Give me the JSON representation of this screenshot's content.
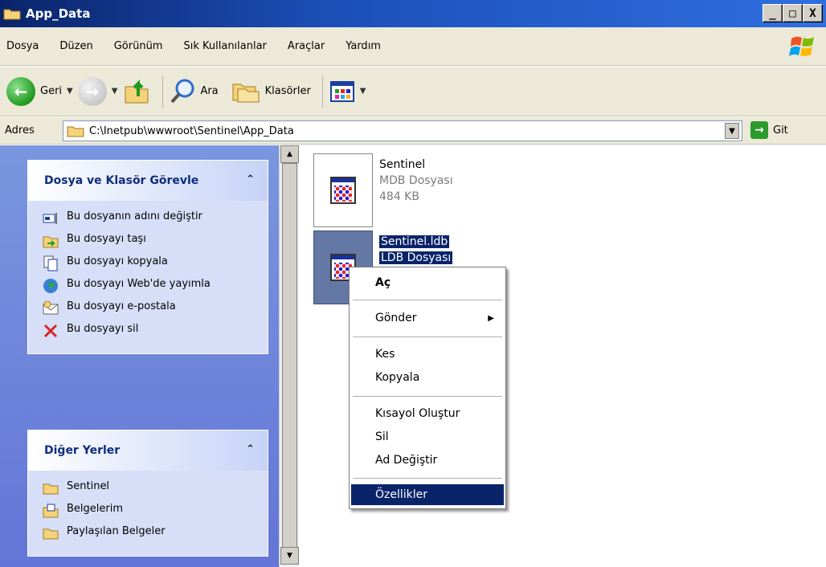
{
  "window": {
    "title": "App_Data",
    "buttons": [
      "_",
      "□",
      "X"
    ]
  },
  "menu": [
    "Dosya",
    "Düzen",
    "Görünüm",
    "Sık Kullanılanlar",
    "Araçlar",
    "Yardım"
  ],
  "toolbar": {
    "back_label": "Geri",
    "search_label": "Ara",
    "folders_label": "Klasörler"
  },
  "address": {
    "label": "Adres",
    "path": "C:\\Inetpub\\wwwroot\\Sentinel\\App_Data",
    "go_label": "Git"
  },
  "file_tasks": {
    "header": "Dosya ve Klasör Görevle",
    "items": [
      "Bu dosyanın adını değiştir",
      "Bu dosyayı taşı",
      "Bu dosyayı kopyala",
      "Bu dosyayı Web'de yayımla",
      "Bu dosyayı e-postala",
      "Bu dosyayı sil"
    ]
  },
  "other_places": {
    "header": "Diğer Yerler",
    "items": [
      "Sentinel",
      "Belgelerim",
      "Paylaşılan Belgeler"
    ]
  },
  "files": [
    {
      "name": "Sentinel",
      "type": "MDB Dosyası",
      "size": "484 KB"
    },
    {
      "name": "Sentinel.ldb",
      "type": "LDB Dosyası"
    }
  ],
  "context_menu": {
    "items": [
      "Aç",
      "Gönder",
      "Kes",
      "Kopyala",
      "Kısayol Oluştur",
      "Sil",
      "Ad Değiştir",
      "Özellikler"
    ],
    "highlighted": "Özellikler"
  },
  "colors": {
    "titlebar": "#0a246a",
    "taskpane_bg": "#6375d6",
    "highlight": "#0a246a"
  }
}
